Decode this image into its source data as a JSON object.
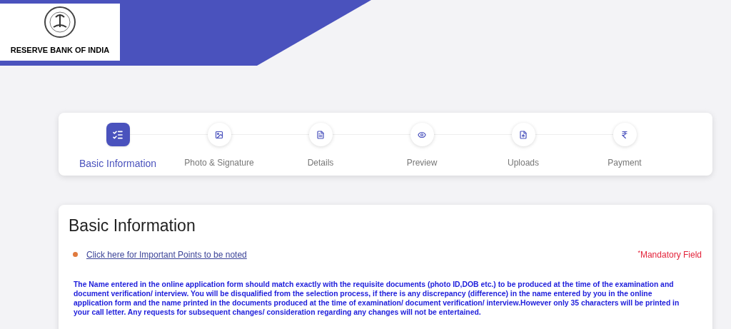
{
  "header": {
    "logo_text": "RESERVE BANK OF INDIA"
  },
  "steps": [
    {
      "label": "Basic Information",
      "kind": "list",
      "selected": true
    },
    {
      "label": "Photo & Signature",
      "kind": "image",
      "selected": false
    },
    {
      "label": "Details",
      "kind": "document",
      "selected": false
    },
    {
      "label": "Preview",
      "kind": "eye",
      "selected": false
    },
    {
      "label": "Uploads",
      "kind": "upload",
      "selected": false
    },
    {
      "label": "Payment",
      "kind": "rupee",
      "selected": false
    }
  ],
  "form": {
    "title": "Basic Information",
    "link": "Click here for Important Points to be noted",
    "mandatory_mark": "*",
    "mandatory": "Mandatory Field",
    "notice": "The Name entered in the online application form should match exactly with the requisite documents (photo ID,DOB etc.) to be produced at the time of the examination and document verification/ interview. You will be disqualified from the selection process, if there is any discrepancy (difference) in the name entered by you in the online application form and the name printed in the documents produced at the time of examination/ document verification/ interview.However only 35 characters will be printed in your call letter. Any requests for subsequent changes/ consideration regarding any changes will not be entertained."
  }
}
